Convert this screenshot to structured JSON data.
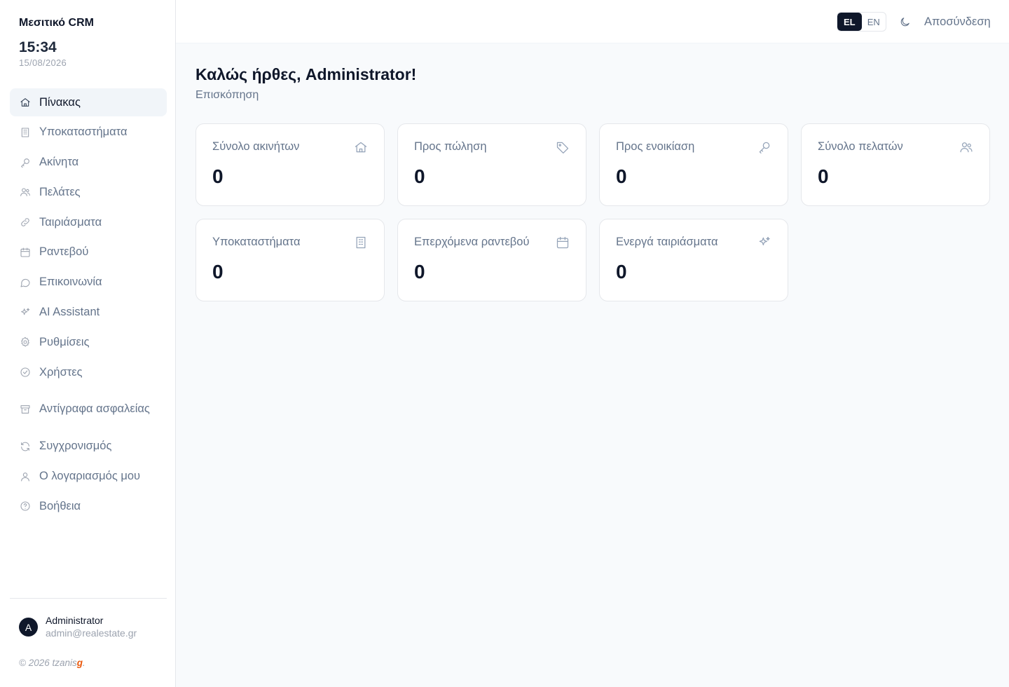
{
  "app": {
    "brand": "Μεσιτικό CRM",
    "time": "15:34",
    "date": "15/08/2026"
  },
  "sidebar": {
    "items": [
      {
        "label": "Πίνακας",
        "icon": "home-icon",
        "active": true
      },
      {
        "label": "Υποκαταστήματα",
        "icon": "building-icon"
      },
      {
        "label": "Ακίνητα",
        "icon": "key-icon"
      },
      {
        "label": "Πελάτες",
        "icon": "users-icon"
      },
      {
        "label": "Ταιριάσματα",
        "icon": "link-icon"
      },
      {
        "label": "Ραντεβού",
        "icon": "calendar-icon"
      },
      {
        "label": "Επικοινωνία",
        "icon": "message-icon"
      },
      {
        "label": "AI Assistant",
        "icon": "sparkles-icon"
      },
      {
        "label": "Ρυθμίσεις",
        "icon": "gear-icon"
      },
      {
        "label": "Χρήστες",
        "icon": "check-circle-icon"
      },
      {
        "label": "Αντίγραφα ασφαλείας",
        "icon": "archive-icon"
      },
      {
        "label": "Συγχρονισμός",
        "icon": "refresh-icon"
      },
      {
        "label": "Ο λογαριασμός μου",
        "icon": "user-icon"
      },
      {
        "label": "Βοήθεια",
        "icon": "help-circle-icon"
      }
    ]
  },
  "user": {
    "initial": "A",
    "name": "Administrator",
    "email": "admin@realestate.gr"
  },
  "footer": {
    "prefix": "© 2026 tzanis",
    "accent": "g",
    "suffix": "."
  },
  "topbar": {
    "lang_active": "EL",
    "lang_other": "EN",
    "theme_icon": "moon-icon",
    "logout_label": "Αποσύνδεση"
  },
  "main": {
    "title": "Καλώς ήρθες, Administrator!",
    "subtitle": "Επισκόπηση",
    "stats": [
      {
        "label": "Σύνολο ακινήτων",
        "value": "0",
        "icon": "home-icon"
      },
      {
        "label": "Προς πώληση",
        "value": "0",
        "icon": "tag-icon"
      },
      {
        "label": "Προς ενοικίαση",
        "value": "0",
        "icon": "key-icon"
      },
      {
        "label": "Σύνολο πελατών",
        "value": "0",
        "icon": "users-icon"
      },
      {
        "label": "Υποκαταστήματα",
        "value": "0",
        "icon": "building-icon"
      },
      {
        "label": "Επερχόμενα ραντεβού",
        "value": "0",
        "icon": "calendar-icon"
      },
      {
        "label": "Ενεργά ταιριάσματα",
        "value": "0",
        "icon": "sparkles-icon"
      }
    ]
  },
  "colors": {
    "accent_dark": "#0f172a",
    "muted_text": "#64748b",
    "footer_accent": "#ea580c",
    "background": "#f8fafc"
  }
}
